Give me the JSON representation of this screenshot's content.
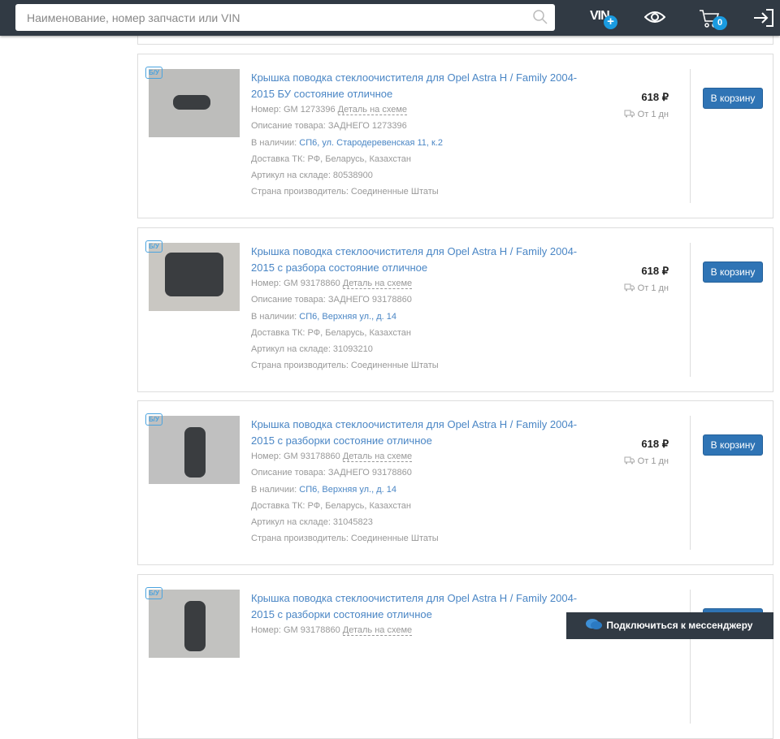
{
  "header": {
    "search_placeholder": "Наименование, номер запчасти или VIN",
    "vin_label": "VIN",
    "vin_plus": "+",
    "cart_count": "0"
  },
  "messenger": {
    "label": "Подключиться к мессенджеру"
  },
  "products": [
    {
      "tag": "Б/У",
      "title": "Крышка поводка стеклоочистителя для Opel Astra H / Family 2004-2015 БУ состояние отличное",
      "number_label": "Номер: GM 1273396",
      "scheme_link": "Деталь на схеме",
      "description": "Описание товара: ЗАДНЕГО 1273396",
      "stock_label": "В наличии:",
      "stock_link": "СП6, ул. Стародеревенская 11, к.2",
      "delivery_info": "Доставка ТК: РФ, Беларусь, Казахстан",
      "sku": "Артикул на складе: 80538900",
      "country": "Страна производитель: Соединенные Штаты",
      "price": "618 ₽",
      "eta": "От 1 дн",
      "button": "В корзину"
    },
    {
      "tag": "Б/У",
      "title": "Крышка поводка стеклоочистителя для Opel Astra H / Family 2004-2015 с разбора состояние отличное",
      "number_label": "Номер: GM 93178860",
      "scheme_link": "Деталь на схеме",
      "description": "Описание товара: ЗАДНЕГО 93178860",
      "stock_label": "В наличии:",
      "stock_link": "СП6, Верхняя ул., д. 14",
      "delivery_info": "Доставка ТК: РФ, Беларусь, Казахстан",
      "sku": "Артикул на складе: 31093210",
      "country": "Страна производитель: Соединенные Штаты",
      "price": "618 ₽",
      "eta": "От 1 дн",
      "button": "В корзину"
    },
    {
      "tag": "Б/У",
      "title": "Крышка поводка стеклоочистителя для Opel Astra H / Family 2004-2015 с разборки состояние отличное",
      "number_label": "Номер: GM 93178860",
      "scheme_link": "Деталь на схеме",
      "description": "Описание товара: ЗАДНЕГО 93178860",
      "stock_label": "В наличии:",
      "stock_link": "СП6, Верхняя ул., д. 14",
      "delivery_info": "Доставка ТК: РФ, Беларусь, Казахстан",
      "sku": "Артикул на складе: 31045823",
      "country": "Страна производитель: Соединенные Штаты",
      "price": "618 ₽",
      "eta": "От 1 дн",
      "button": "В корзину"
    },
    {
      "tag": "Б/У",
      "title": "Крышка поводка стеклоочистителя для Opel Astra H / Family 2004-2015 с разборки состояние отличное",
      "number_label": "Номер: GM 93178860",
      "scheme_link": "Деталь на схеме",
      "button": "В корзину"
    }
  ]
}
